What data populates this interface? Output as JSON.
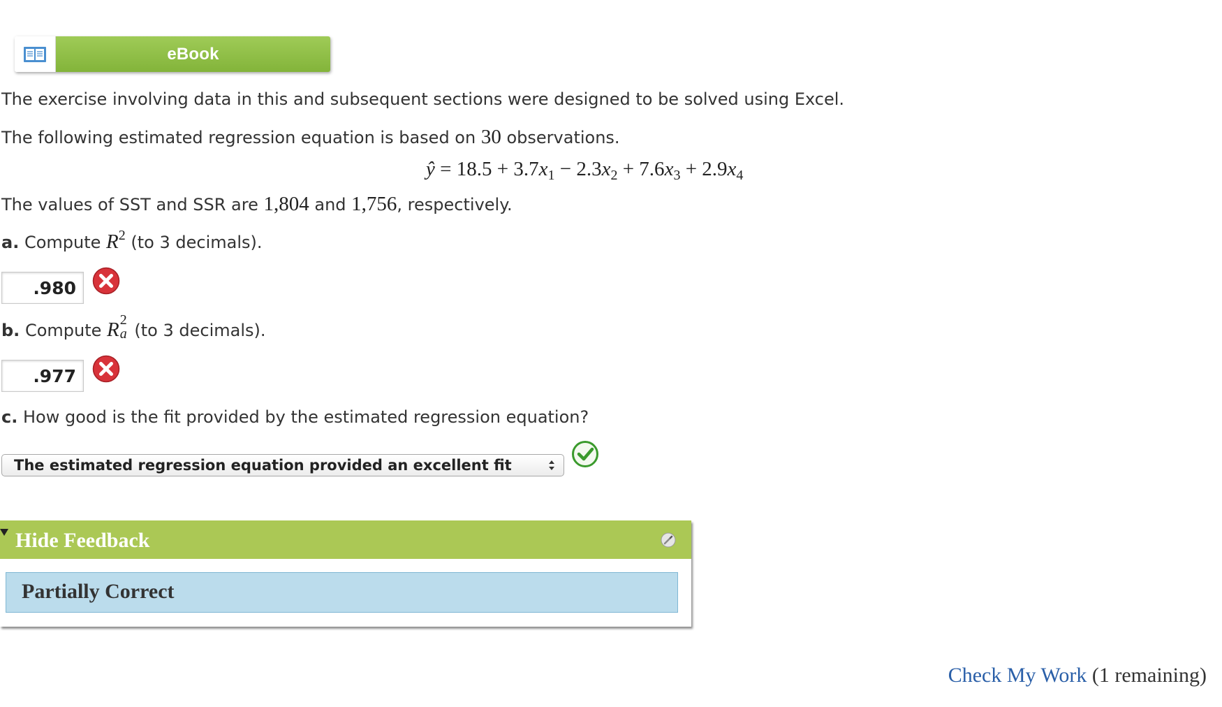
{
  "ebook": {
    "label": "eBook",
    "icon": "open-book-icon"
  },
  "intro": "The exercise involving data in this and subsequent sections were designed to be solved using Excel.",
  "regression": {
    "sentence_prefix": "The following estimated regression equation is based on",
    "observations": "30",
    "sentence_suffix": "observations.",
    "equation": {
      "lhs": "ŷ",
      "eq": "=",
      "terms": [
        "18.5",
        "+ 3.7",
        "− 2.3",
        "+ 7.6",
        "+ 2.9"
      ],
      "subscripts": [
        "1",
        "2",
        "3",
        "4"
      ]
    }
  },
  "values_sentence": {
    "prefix": "The values of SST and SSR are",
    "sst": "1,804",
    "and": "and",
    "ssr": "1,756",
    "suffix": ", respectively."
  },
  "questions": {
    "a": {
      "letter": "a.",
      "text_before": "Compute",
      "symbol": "R",
      "sup": "2",
      "text_after": "(to 3 decimals).",
      "answer": ".980",
      "status": "incorrect",
      "status_icon": "incorrect-x-icon"
    },
    "b": {
      "letter": "b.",
      "text_before": "Compute",
      "symbol": "R",
      "sup": "2",
      "sub": "a",
      "text_after": "(to 3 decimals).",
      "answer": ".977",
      "status": "incorrect",
      "status_icon": "incorrect-x-icon"
    },
    "c": {
      "letter": "c.",
      "text": "How good is the fit provided by the estimated regression equation?",
      "selected_option": "The estimated regression equation provided an excellent fit",
      "status": "correct",
      "status_icon": "correct-check-icon"
    }
  },
  "feedback": {
    "toggle_label": "Hide Feedback",
    "message": "Partially Correct",
    "header_color": "#abc855",
    "body_color": "#bbdcec"
  },
  "footer": {
    "check_label": "Check My Work",
    "remaining": "(1 remaining)"
  },
  "colors": {
    "incorrect": "#d8333a",
    "correct": "#3a9a2c",
    "link": "#2a5fa8"
  }
}
